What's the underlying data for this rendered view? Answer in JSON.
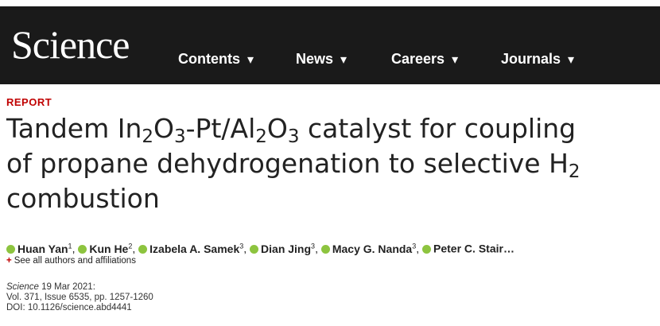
{
  "header": {
    "logo": "Science",
    "nav": [
      {
        "label": "Contents"
      },
      {
        "label": "News"
      },
      {
        "label": "Careers"
      },
      {
        "label": "Journals"
      }
    ],
    "dropdown_glyph": "▾"
  },
  "article": {
    "type": "REPORT",
    "title": {
      "line1_a": "Tandem In",
      "sub1": "2",
      "line1_b": "O",
      "sub2": "3",
      "line1_c": "-Pt/Al",
      "sub3": "2",
      "line1_d": "O",
      "sub4": "3",
      "line1_e": " catalyst for coupling",
      "line2": "of propane dehydrogenation to selective H",
      "sub5": "2",
      "line3": "combustion"
    },
    "authors": [
      {
        "name": "Huan Yan",
        "aff": "1"
      },
      {
        "name": "Kun He",
        "aff": "2"
      },
      {
        "name": "Izabela A. Samek",
        "aff": "3"
      },
      {
        "name": "Dian Jing",
        "aff": "3"
      },
      {
        "name": "Macy G. Nanda",
        "aff": "3"
      },
      {
        "name": "Peter C. Stair…",
        "aff": ""
      }
    ],
    "see_all": "See all authors and affiliations",
    "journal": "Science",
    "date": "19 Mar 2021:",
    "volume": "Vol. 371, Issue 6535, pp. 1257-1260",
    "doi": "DOI: 10.1126/science.abd4441"
  },
  "colors": {
    "header_bg": "#1a1a1a",
    "accent_red": "#c00000",
    "orcid_green": "#8dc43f"
  }
}
